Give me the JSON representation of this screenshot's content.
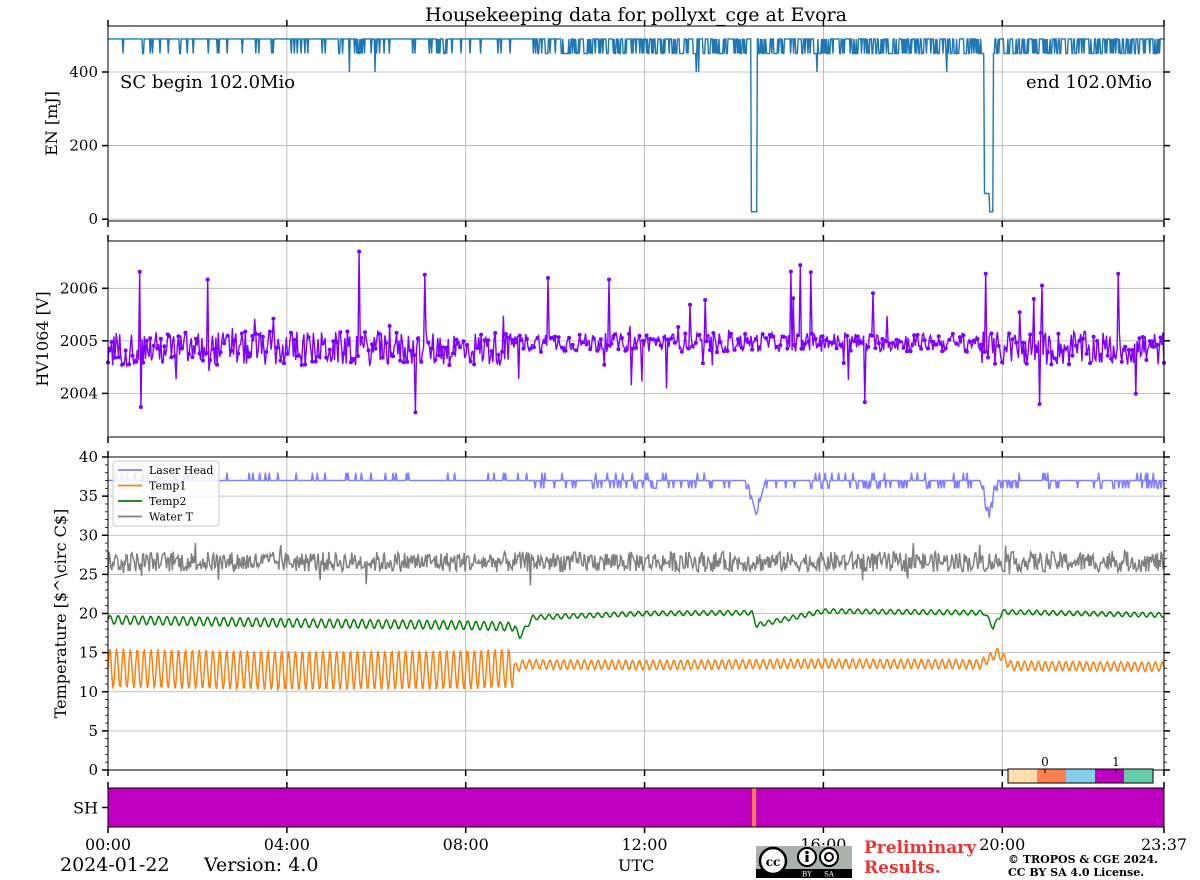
{
  "title": "Housekeeping data for pollyxt_cge at Evora",
  "date": "2024-01-22",
  "version": "Version: 4.0",
  "xlabel": "UTC",
  "preliminary": [
    "Preliminary",
    "Results."
  ],
  "copyright": [
    "© TROPOS & CGE 2024.",
    "CC BY SA 4.0 License."
  ],
  "license_badge": {
    "text_by": "BY",
    "text_sa": "SA"
  },
  "colors": {
    "energy": "#1f77b4",
    "hv": "#8000ff",
    "laser_head": "#8080ff",
    "temp1": "#ff7f0e",
    "temp2": "#008000",
    "water": "#808080",
    "shutter": "#c000c0",
    "shutter_event": "#ff7f50",
    "preliminary": "#ee3333"
  },
  "chart_data": [
    {
      "type": "line",
      "name": "energy",
      "ylabel": "EN [mJ]",
      "ylim": [
        -5,
        525
      ],
      "yticks": [
        0,
        200,
        400
      ],
      "xlim": [
        0,
        23.617
      ],
      "xticks": [
        "00:00",
        "04:00",
        "08:00",
        "12:00",
        "16:00",
        "20:00",
        "23:37"
      ],
      "annotations": {
        "left": "SC begin 102.0Mio",
        "right": "end 102.0Mio"
      },
      "baseline": 490,
      "dip_level": 450,
      "series": [
        {
          "values_description_free": true,
          "x": [
            0,
            1,
            2,
            4,
            6,
            8,
            9.5,
            10.5,
            12,
            14,
            14.4,
            14.5,
            14.6,
            16,
            18,
            19.6,
            19.7,
            19.9,
            20,
            22,
            23.6
          ],
          "values": [
            490,
            490,
            490,
            490,
            490,
            490,
            490,
            450,
            470,
            470,
            20,
            20,
            470,
            470,
            470,
            70,
            20,
            20,
            470,
            470,
            470
          ]
        }
      ],
      "grid": true
    },
    {
      "type": "line",
      "name": "hv",
      "ylabel": "HV1064 [V]",
      "ylim": [
        2003.17,
        2006.9
      ],
      "yticks": [
        2004,
        2005,
        2006
      ],
      "xlim": [
        0,
        23.617
      ],
      "series": [
        {
          "mean": 2004.85,
          "min": 2003.25,
          "max": 2006.75
        }
      ],
      "grid": true
    },
    {
      "type": "line",
      "name": "temperature",
      "ylabel": "Temperature [$^\\circ C$]",
      "ylim": [
        0,
        40
      ],
      "yticks": [
        0,
        5,
        10,
        15,
        20,
        25,
        30,
        35,
        40
      ],
      "xlim": [
        0,
        23.617
      ],
      "legend": "top-left",
      "series": [
        {
          "name": "Laser Head",
          "x": [
            0,
            9.5,
            14.3,
            14.5,
            14.7,
            19.5,
            19.7,
            19.9,
            23.6
          ],
          "values": [
            37,
            37,
            37,
            32.5,
            37,
            37,
            33,
            37,
            37
          ]
        },
        {
          "name": "Temp1",
          "x": [
            0,
            4,
            8,
            9.1,
            9.3,
            12,
            16,
            19.5,
            19.9,
            20.2,
            23.6
          ],
          "values": [
            13,
            12.7,
            12.8,
            13,
            13.5,
            13.4,
            13.6,
            13.5,
            15,
            13.3,
            13.2
          ]
        },
        {
          "name": "Temp2",
          "x": [
            0,
            4,
            8,
            9.1,
            9.2,
            9.5,
            12,
            14.4,
            14.5,
            16,
            19.6,
            19.8,
            20,
            23.6
          ],
          "values": [
            19.2,
            18.8,
            18.5,
            18.3,
            17,
            19.5,
            20,
            20.1,
            18.5,
            20.3,
            20.1,
            18.2,
            20.2,
            19.8
          ]
        },
        {
          "name": "Water T",
          "mean": 26.6,
          "min": 23.2,
          "max": 29
        }
      ],
      "grid": true
    },
    {
      "type": "heatmap",
      "name": "shutter",
      "ylabel": "SH",
      "xlim": [
        0,
        23.617
      ],
      "colorbar_ticks": [
        "0",
        "1"
      ],
      "colorbar_colors": [
        "#ffdead",
        "#ff7f50",
        "#87ceeb",
        "#c000c0",
        "#66cdaa"
      ],
      "events": [
        {
          "x": 14.45,
          "value": "event"
        }
      ]
    }
  ]
}
